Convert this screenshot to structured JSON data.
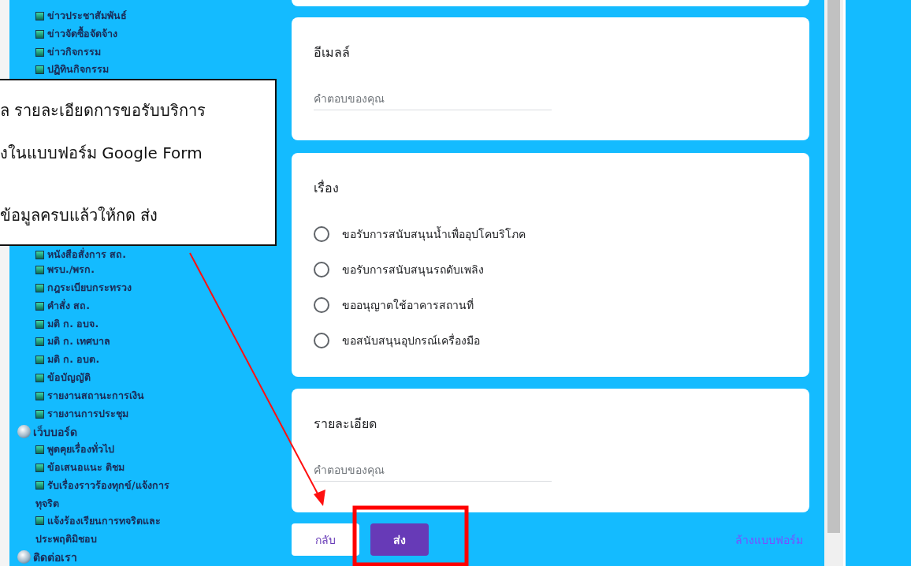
{
  "sidebar": {
    "sections": [
      {
        "items": [
          "ข่าวประชาสัมพันธ์",
          "ข่าวจัดซื้อจัดจ้าง",
          "ข่าวกิจกรรม",
          "ปฏิทินกิจกรรม"
        ]
      },
      {
        "items": [
          "หนังสือสั่งการ สถ.",
          "พรบ./พรก.",
          "กฎระเบียบกระทรวง",
          "คำสั่ง สถ.",
          "มติ ก. อบจ.",
          "มติ ก. เทศบาล",
          "มติ ก. อบต.",
          "ข้อบัญญัติ",
          "รายงานสถานะการเงิน",
          "รายงานการประชุม"
        ]
      },
      {
        "header": "เว็บบอร์ด",
        "items": [
          "พูดคุยเรื่องทั่วไป",
          "ข้อเสนอแนะ ติชม",
          "รับเรื่องราวร้องทุกข์/แจ้งการ ทุจริต",
          "แจ้งร้องเรียนการทจริตและ ประพฤติมิชอบ"
        ]
      },
      {
        "header": "ติดต่อเรา"
      }
    ]
  },
  "callout": {
    "lines": [
      "ล รายละเอียดการขอรับบริการ",
      "งในแบบฟอร์ม Google Form",
      "ข้อมูลครบแล้วให้กด ส่ง"
    ]
  },
  "form": {
    "questions": [
      {
        "kind": "text",
        "title": "อีเมลล์",
        "placeholder": "คำตอบของคุณ"
      },
      {
        "kind": "choice",
        "title": "เรื่อง",
        "options": [
          {
            "label": "ขอรับการสนับสนุนน้ำเพื่ออุปโคบริโภค",
            "selected": false
          },
          {
            "label": "ขอรับการสนับสนุนรถดับเพลิง",
            "selected": false
          },
          {
            "label": "ขออนุญาตใช้อาคารสถานที่",
            "selected": false
          },
          {
            "label": "ขอสนับสนุนอุปกรณ์เครื่องมือ",
            "selected": false
          }
        ]
      },
      {
        "kind": "text",
        "title": "รายละเอียด",
        "placeholder": "คำตอบของคุณ"
      }
    ],
    "back_button": "กลับ",
    "submit_button": "ส่ง",
    "clear_link": "ล้างแบบฟอร์ม"
  }
}
